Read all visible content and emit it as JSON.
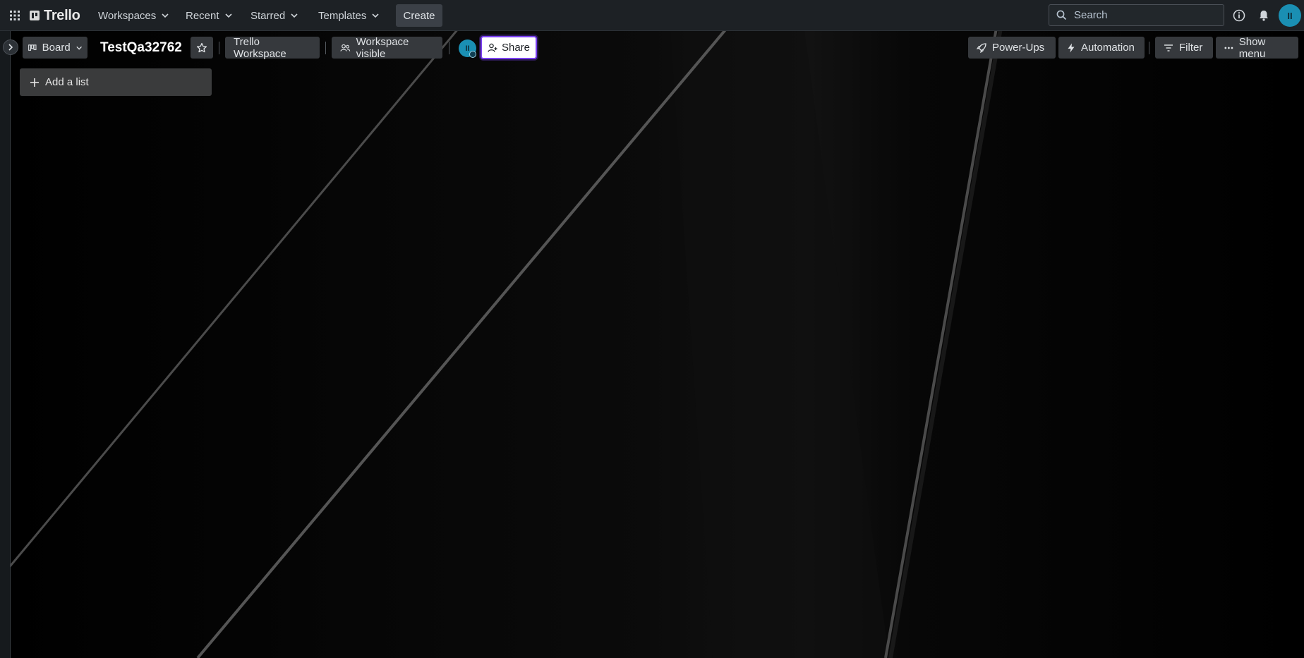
{
  "nav": {
    "app_name": "Trello",
    "menus": [
      {
        "label": "Workspaces"
      },
      {
        "label": "Recent"
      },
      {
        "label": "Starred"
      },
      {
        "label": "Templates"
      }
    ],
    "create_label": "Create",
    "search_placeholder": "Search",
    "avatar_initials": "II"
  },
  "board": {
    "view_label": "Board",
    "title": "TestQa32762",
    "workspace_label": "Trello Workspace",
    "visibility_label": "Workspace visible",
    "member_initials": "II",
    "share_label": "Share",
    "powerups_label": "Power-Ups",
    "automation_label": "Automation",
    "filter_label": "Filter",
    "menu_label": "Show menu",
    "add_list_label": "Add a list"
  },
  "colors": {
    "accent": "#1a8fb3",
    "share_focus": "#7a3ff0"
  }
}
